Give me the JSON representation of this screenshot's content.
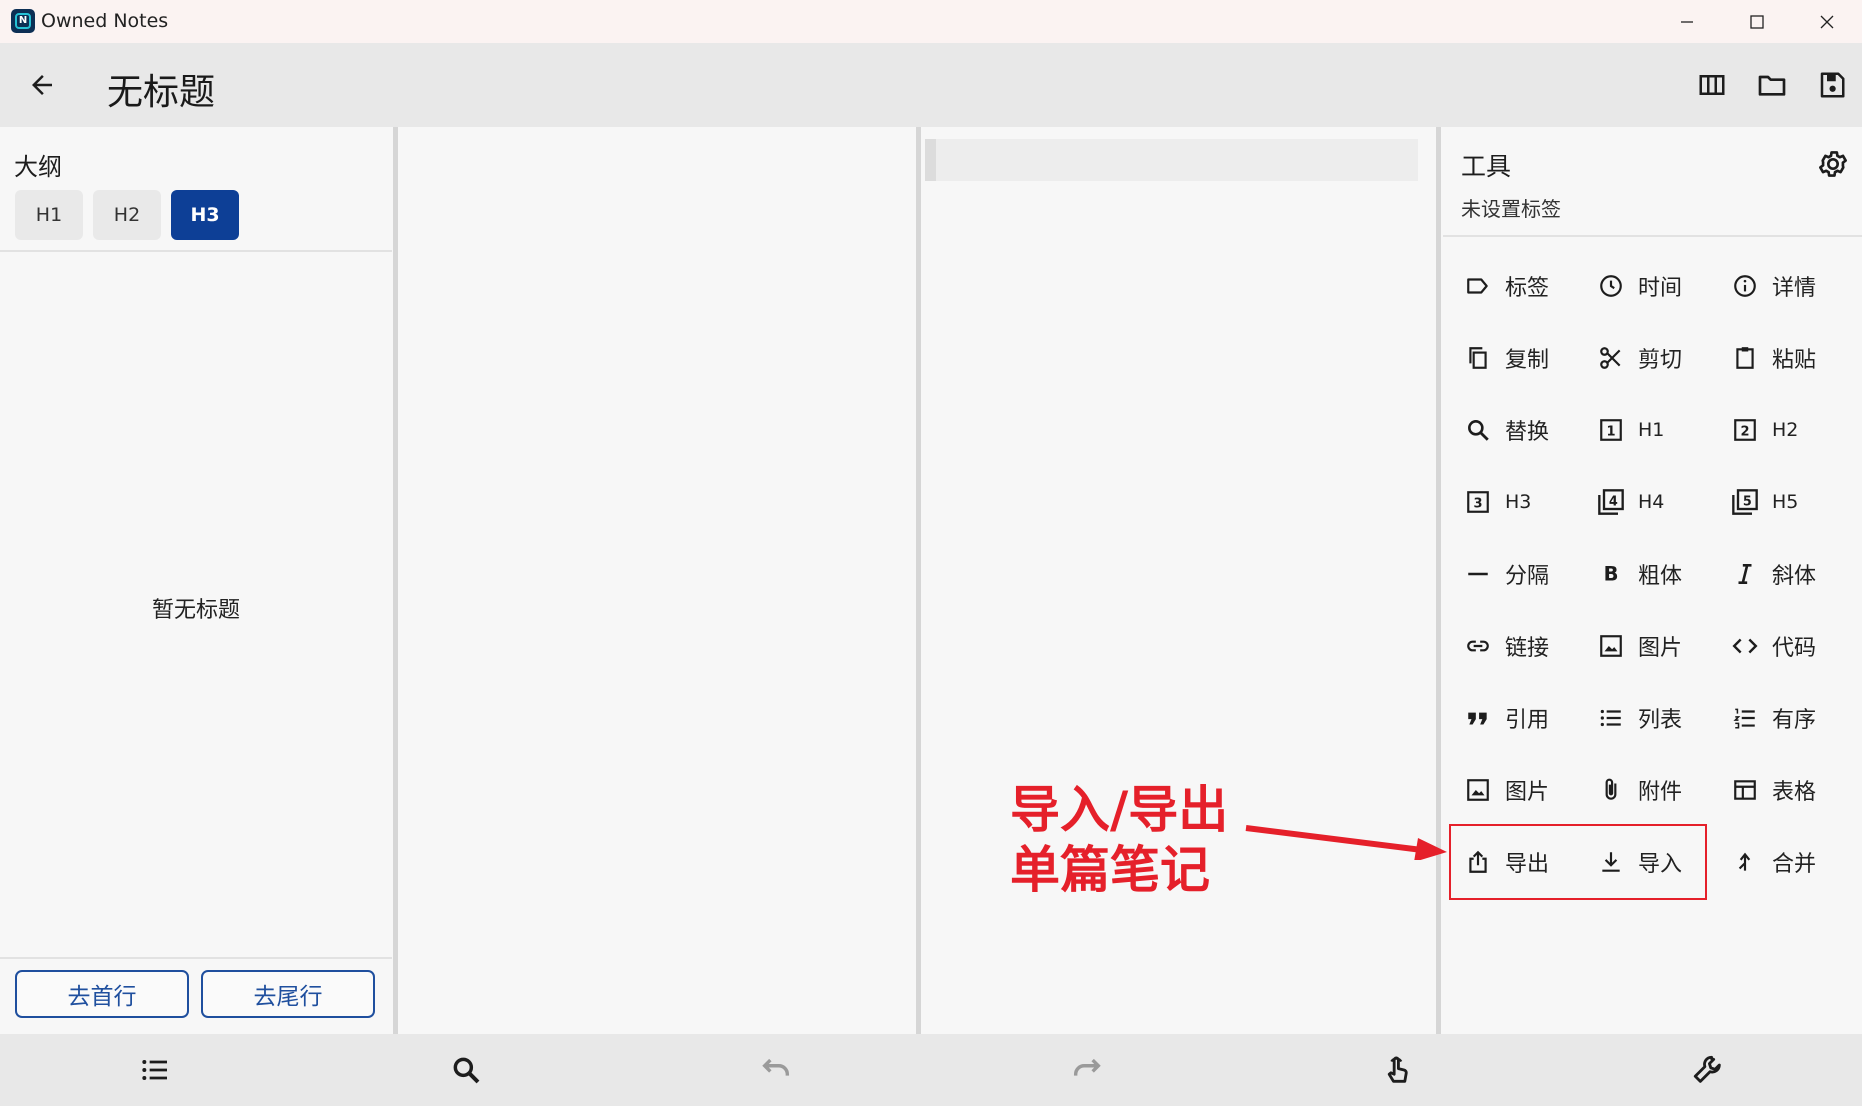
{
  "window": {
    "title": "Owned Notes",
    "logo_letter": "N"
  },
  "appbar": {
    "title": "无标题"
  },
  "outline": {
    "title": "大纲",
    "heading_filters": [
      "H1",
      "H2",
      "H3"
    ],
    "active_filter": "H3",
    "empty_text": "暂无标题",
    "go_first_label": "去首行",
    "go_last_label": "去尾行"
  },
  "tools": {
    "title": "工具",
    "subtitle": "未设置标签",
    "items": [
      {
        "label": "标签",
        "icon": "label-icon"
      },
      {
        "label": "时间",
        "icon": "clock-icon"
      },
      {
        "label": "详情",
        "icon": "info-icon"
      },
      {
        "label": "复制",
        "icon": "copy-icon"
      },
      {
        "label": "剪切",
        "icon": "scissors-icon"
      },
      {
        "label": "粘贴",
        "icon": "clipboard-icon"
      },
      {
        "label": "替换",
        "icon": "search-icon"
      },
      {
        "label": "H1",
        "icon": "h1-box-icon"
      },
      {
        "label": "H2",
        "icon": "h2-box-icon"
      },
      {
        "label": "H3",
        "icon": "h3-box-icon"
      },
      {
        "label": "H4",
        "icon": "h4-box-icon"
      },
      {
        "label": "H5",
        "icon": "h5-box-icon"
      },
      {
        "label": "分隔",
        "icon": "horizontal-rule-icon"
      },
      {
        "label": "粗体",
        "icon": "bold-icon"
      },
      {
        "label": "斜体",
        "icon": "italic-icon"
      },
      {
        "label": "链接",
        "icon": "link-icon"
      },
      {
        "label": "图片",
        "icon": "image-icon"
      },
      {
        "label": "代码",
        "icon": "code-icon"
      },
      {
        "label": "引用",
        "icon": "quote-icon"
      },
      {
        "label": "列表",
        "icon": "bullet-list-icon"
      },
      {
        "label": "有序",
        "icon": "numbered-list-icon"
      },
      {
        "label": "图片",
        "icon": "image-icon"
      },
      {
        "label": "附件",
        "icon": "attachment-icon"
      },
      {
        "label": "表格",
        "icon": "table-icon"
      },
      {
        "label": "导出",
        "icon": "export-icon"
      },
      {
        "label": "导入",
        "icon": "import-icon"
      },
      {
        "label": "合并",
        "icon": "merge-icon"
      }
    ]
  },
  "annotation": {
    "line1": "导入/导出",
    "line2": "单篇笔记",
    "color": "#e5202a"
  },
  "colors": {
    "accent": "#0d3f96",
    "outline_button": "#1f4f9e"
  }
}
